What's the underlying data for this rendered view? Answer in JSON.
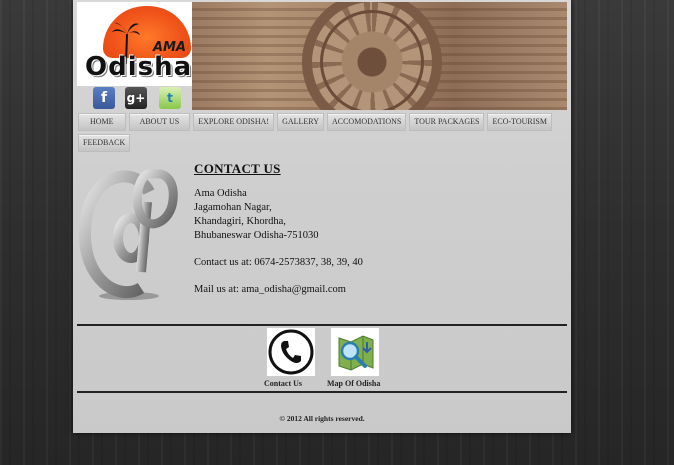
{
  "site": {
    "logo_ama": "AMA",
    "logo_text": "Odisha"
  },
  "social": [
    {
      "name": "facebook-icon",
      "glyph": "f"
    },
    {
      "name": "google-plus-icon",
      "glyph": "g+"
    },
    {
      "name": "twitter-icon",
      "glyph": "t"
    }
  ],
  "nav": {
    "row1": [
      "HOME",
      "ABOUT US",
      "EXPLORE ODISHA!",
      "GALLERY",
      "ACCOMODATIONS",
      "TOUR PACKAGES",
      "ECO-TOURISM"
    ],
    "row2": [
      "FEEDBACK"
    ]
  },
  "contact": {
    "title": "CONTACT US",
    "name": "Ama Odisha",
    "address_lines": [
      "Jagamohan Nagar,",
      "Khandagiri, Khordha,",
      "Bhubaneswar Odisha-751030"
    ],
    "phone_line": "Contact us at: 0674-2573837, 38, 39, 40",
    "mail_line": "Mail us at: ama_odisha@gmail.com"
  },
  "links": {
    "contact_label": "Contact Us",
    "map_label": "Map Of Odisha"
  },
  "footer": {
    "copyright": "© 2012 All rights reserved."
  },
  "colors": {
    "page_bg": "#cfcfcf",
    "logo_sun": "#f0541a",
    "facebook": "#3b5998"
  }
}
